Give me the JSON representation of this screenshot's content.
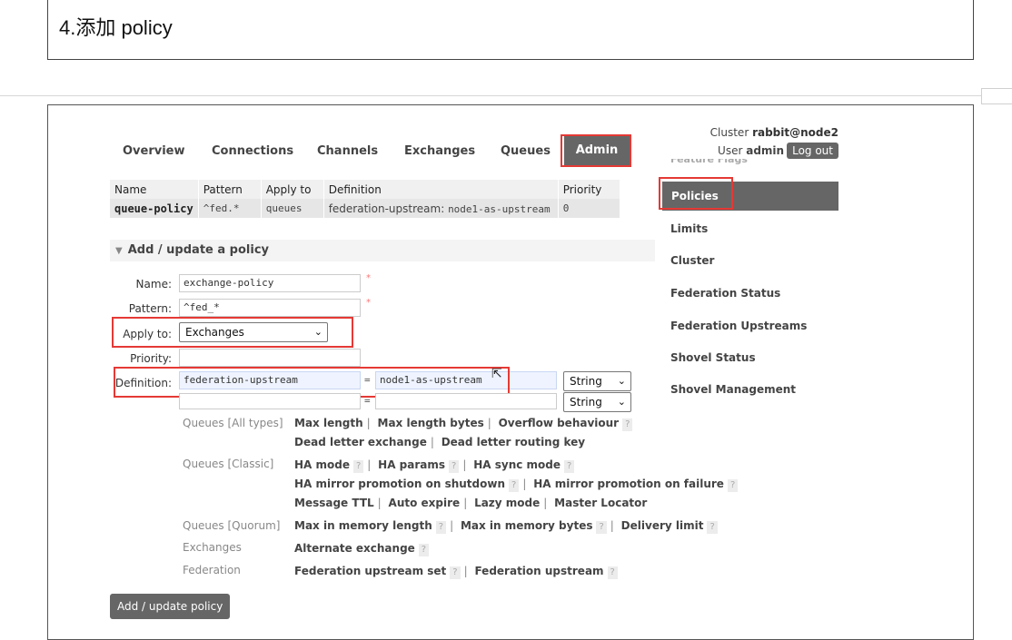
{
  "doc": {
    "title": "4.添加 policy"
  },
  "nav": {
    "tabs": [
      "Overview",
      "Connections",
      "Channels",
      "Exchanges",
      "Queues",
      "Admin"
    ]
  },
  "cluster": {
    "label": "Cluster",
    "name": "rabbit@node2",
    "user_label": "User",
    "user": "admin",
    "logout": "Log out"
  },
  "policies_table": {
    "headers": [
      "Name",
      "Pattern",
      "Apply to",
      "Definition",
      "Priority"
    ],
    "row": {
      "name": "queue-policy",
      "pattern": "^fed.*",
      "apply_to": "queues",
      "def_key": "federation-upstream:",
      "def_val": "node1-as-upstream",
      "priority": "0"
    }
  },
  "form": {
    "section_title": "Add / update a policy",
    "name_label": "Name:",
    "name_value": "exchange-policy",
    "pattern_label": "Pattern:",
    "pattern_value": "^fed_*",
    "apply_label": "Apply to:",
    "apply_value": "Exchanges",
    "priority_label": "Priority:",
    "priority_value": "",
    "definition_label": "Definition:",
    "def_key": "federation-upstream",
    "def_val": "node1-as-upstream",
    "eq": "=",
    "type1": "String",
    "type2": "String",
    "star": "*"
  },
  "groups": {
    "queues_all": "Queues [All types]",
    "queues_classic": "Queues [Classic]",
    "queues_quorum": "Queues [Quorum]",
    "exchanges": "Exchanges",
    "federation": "Federation"
  },
  "links": {
    "max_length": "Max length",
    "max_length_bytes": "Max length bytes",
    "overflow": "Overflow behaviour",
    "dl_exchange": "Dead letter exchange",
    "dl_routing_key": "Dead letter routing key",
    "ha_mode": "HA mode",
    "ha_params": "HA params",
    "ha_sync_mode": "HA sync mode",
    "ha_promo_shutdown": "HA mirror promotion on shutdown",
    "ha_promo_failure": "HA mirror promotion on failure",
    "message_ttl": "Message TTL",
    "auto_expire": "Auto expire",
    "lazy_mode": "Lazy mode",
    "master_locator": "Master Locator",
    "max_in_mem_length": "Max in memory length",
    "max_in_mem_bytes": "Max in memory bytes",
    "delivery_limit": "Delivery limit",
    "alt_exchange": "Alternate exchange",
    "fed_upstream_set": "Federation upstream set",
    "fed_upstream": "Federation upstream",
    "help": "?",
    "sep": "|"
  },
  "submit": "Add / update policy",
  "sidebar": {
    "partial": "Feature Flags",
    "items": [
      "Policies",
      "Limits",
      "Cluster",
      "Federation Status",
      "Federation Upstreams",
      "Shovel Status",
      "Shovel Management"
    ]
  }
}
